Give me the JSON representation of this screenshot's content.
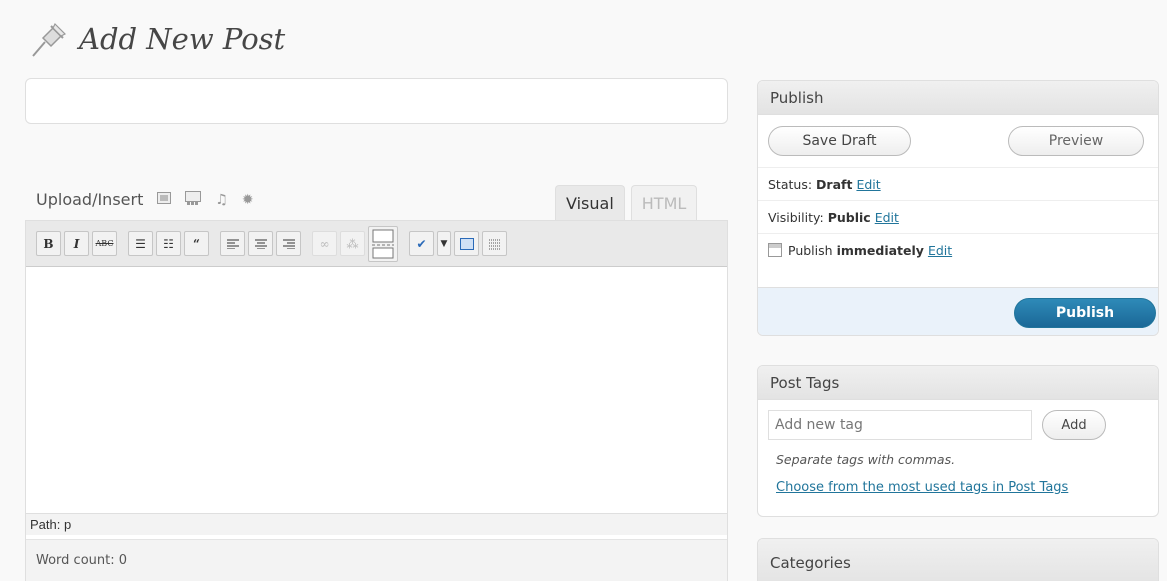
{
  "header": {
    "title": "Add New Post",
    "icon": "pin-icon"
  },
  "title_input": {
    "value": "",
    "placeholder": ""
  },
  "upload": {
    "label": "Upload/Insert",
    "icons": [
      "image-icon",
      "gallery-icon",
      "audio-icon",
      "media-icon"
    ]
  },
  "editor": {
    "tabs": [
      {
        "label": "Visual"
      },
      {
        "label": "HTML"
      }
    ],
    "toolbar": [
      "bold-icon",
      "italic-icon",
      "strikethrough-icon",
      "unordered-list-icon",
      "ordered-list-icon",
      "blockquote-icon",
      "align-left-icon",
      "align-center-icon",
      "align-right-icon",
      "link-icon",
      "unlink-icon",
      "more-tag-icon",
      "spellcheck-icon",
      "dropdown-icon",
      "fullscreen-icon",
      "kitchen-sink-icon"
    ],
    "bold_label": "B",
    "italic_label": "I",
    "strike_label": "ABC",
    "path": "Path: p",
    "word_count": "Word count: 0"
  },
  "publish_box": {
    "title": "Publish",
    "save_draft": "Save Draft",
    "preview": "Preview",
    "status_label": "Status:",
    "status_value": "Draft",
    "visibility_label": "Visibility:",
    "visibility_value": "Public",
    "publish_label": "Publish",
    "publish_value": "immediately",
    "edit": "Edit",
    "publish_button": "Publish"
  },
  "tags_box": {
    "title": "Post Tags",
    "placeholder": "Add new tag",
    "add_button": "Add",
    "hint": "Separate tags with commas.",
    "link": "Choose from the most used tags in Post Tags"
  },
  "categories_box": {
    "title": "Categories"
  },
  "colors": {
    "link": "#21759b",
    "publish_button": "#21759b",
    "background": "#f9f9f9"
  }
}
